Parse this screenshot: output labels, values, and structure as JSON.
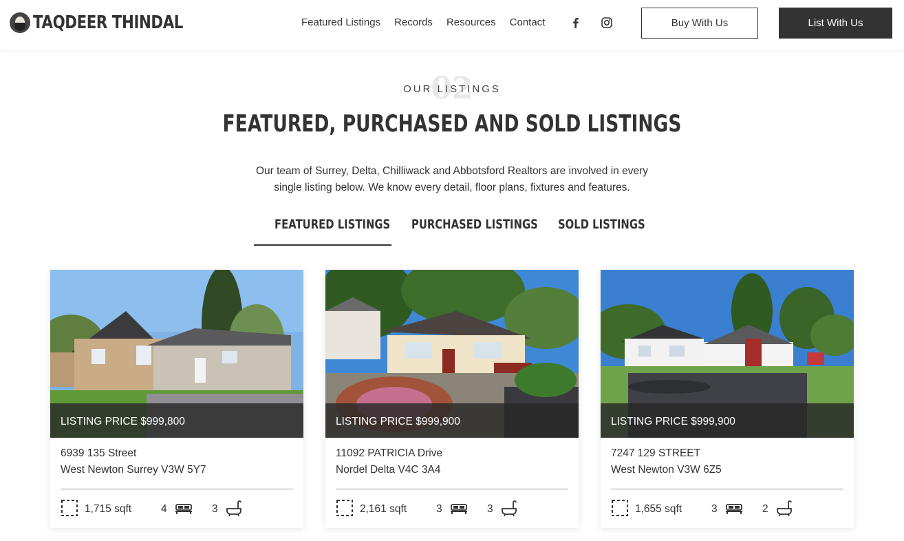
{
  "brand": {
    "name": "TAQDEER THINDAL"
  },
  "nav": {
    "items": [
      "Featured Listings",
      "Records",
      "Resources",
      "Contact"
    ],
    "social": [
      "facebook-icon",
      "instagram-icon"
    ],
    "buy_label": "Buy With Us",
    "list_label": "List With Us"
  },
  "section": {
    "number": "02",
    "eyebrow": "OUR LISTINGS",
    "title": "FEATURED, PURCHASED AND SOLD LISTINGS",
    "intro_line1": "Our team of Surrey, Delta, Chilliwack and Abbotsford Realtors are involved in every",
    "intro_line2": "single listing below. We know every detail, floor plans, fixtures and features."
  },
  "tabs": [
    {
      "label": "FEATURED LISTINGS",
      "active": true
    },
    {
      "label": "PURCHASED LISTINGS",
      "active": false
    },
    {
      "label": "SOLD LISTINGS",
      "active": false
    }
  ],
  "listings": [
    {
      "price": "LISTING PRICE $999,800",
      "address_line1": "6939 135 Street",
      "address_line2": "West Newton Surrey V3W 5Y7",
      "sqft": "1,715 sqft",
      "beds": "4",
      "baths": "3"
    },
    {
      "price": "LISTING PRICE $999,900",
      "address_line1": "11092 PATRICIA Drive",
      "address_line2": "Nordel Delta V4C 3A4",
      "sqft": "2,161 sqft",
      "beds": "3",
      "baths": "3"
    },
    {
      "price": "LISTING PRICE $999,900",
      "address_line1": "7247 129 STREET",
      "address_line2": "West Newton V3W 6Z5",
      "sqft": "1,655 sqft",
      "beds": "3",
      "baths": "2"
    }
  ],
  "colors": {
    "dark": "#333333",
    "overlay": "#282828",
    "muted": "#e8e8e8"
  }
}
